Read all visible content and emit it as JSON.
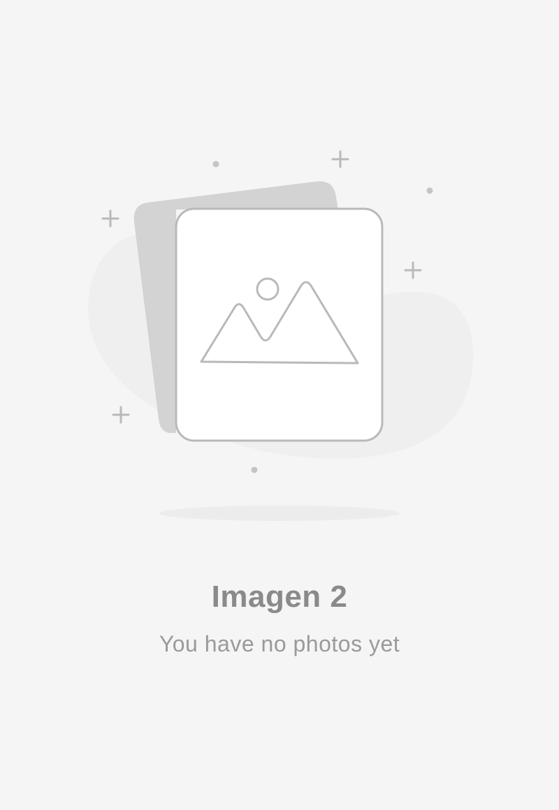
{
  "empty_state": {
    "title": "Imagen 2",
    "message": "You have no photos yet",
    "illustration_icon": "image-placeholder-icon"
  },
  "colors": {
    "background": "#f5f5f5",
    "title": "#8a8a8a",
    "message": "#9a9a9a",
    "icon_stroke": "#b9b9b9",
    "back_card": "#d3d3d3",
    "front_card": "#ffffff"
  }
}
